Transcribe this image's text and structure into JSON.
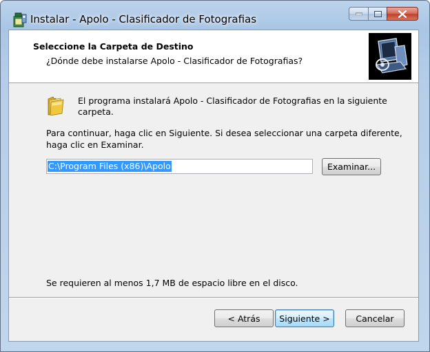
{
  "window": {
    "title": "Instalar - Apolo - Clasificador de Fotografias",
    "caption_buttons": {
      "minimize": "minimize-icon",
      "maximize": "maximize-icon",
      "close": "close-icon"
    }
  },
  "header": {
    "title": "Seleccione la Carpeta de Destino",
    "subtitle": "¿Dónde debe instalarse Apolo - Clasificador de Fotografias?"
  },
  "body": {
    "install_line1": "El programa instalará Apolo - Clasificador de Fotografias en la siguiente",
    "install_line2": "carpeta.",
    "continue_line1": "Para continuar, haga clic en Siguiente. Si desea seleccionar una carpeta diferente,",
    "continue_line2": "haga clic en Examinar.",
    "path_value": "C:\\Program Files (x86)\\Apolo",
    "browse_label": "Examinar...",
    "space_required": "Se requieren al menos 1,7 MB de espacio libre en el disco."
  },
  "footer": {
    "back_label": "< Atrás",
    "next_label": "Siguiente >",
    "cancel_label": "Cancelar"
  }
}
